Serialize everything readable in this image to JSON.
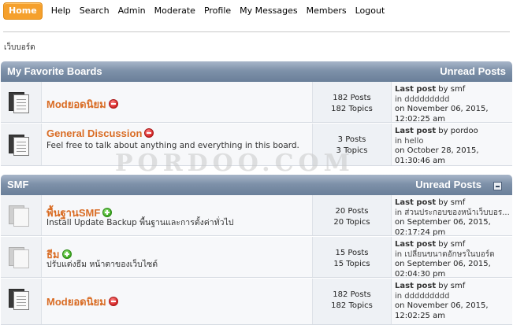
{
  "menu": {
    "items": [
      "Home",
      "Help",
      "Search",
      "Admin",
      "Moderate",
      "Profile",
      "My Messages",
      "Members",
      "Logout"
    ],
    "active": "Home"
  },
  "breadcrumb": "เว็บบอร์ด",
  "watermark": "PORDOO.COM",
  "categories": [
    {
      "title": "My Favorite Boards",
      "unread_label": "Unread Posts",
      "boards": [
        {
          "name": "Modยอดนิยม",
          "status": "red",
          "description": "",
          "posts": "182 Posts",
          "topics": "182 Topics",
          "last_post_label": "Last post",
          "last_post_by": "by smf",
          "last_post_in": "in ddddddddd",
          "last_post_date": "on November 06, 2015,",
          "last_post_time": "12:02:25 am"
        },
        {
          "name": "General Discussion",
          "status": "red",
          "description": "Feel free to talk about anything and everything in this board.",
          "posts": "3 Posts",
          "topics": "3 Topics",
          "last_post_label": "Last post",
          "last_post_by": "by pordoo",
          "last_post_in": "in hello",
          "last_post_date": "on October 28, 2015,",
          "last_post_time": "01:30:46 am"
        }
      ]
    },
    {
      "title": "SMF",
      "unread_label": "Unread Posts",
      "boards": [
        {
          "name": "พื้นฐานSMF",
          "status": "green",
          "description": "Install Update Backup พื้นฐานและการตั้งค่าทั่วไป",
          "posts": "20 Posts",
          "topics": "20 Topics",
          "last_post_label": "Last post",
          "last_post_by": "by smf",
          "last_post_in": "in ส่วนประกอบของหน้าเว็บบอร...",
          "last_post_date": "on September 06, 2015,",
          "last_post_time": "02:17:24 pm"
        },
        {
          "name": "ธีม",
          "status": "green",
          "description": "ปรับแต่งธีม หน้าตาของเว็บไซต์",
          "posts": "15 Posts",
          "topics": "15 Topics",
          "last_post_label": "Last post",
          "last_post_by": "by smf",
          "last_post_in": "in เปลี่ยนขนาดอักษรในบอร์ด",
          "last_post_date": "on September 06, 2015,",
          "last_post_time": "02:04:30 pm"
        },
        {
          "name": "Modยอดนิยม",
          "status": "red",
          "description": "",
          "posts": "182 Posts",
          "topics": "182 Topics",
          "last_post_label": "Last post",
          "last_post_by": "by smf",
          "last_post_in": "in ddddddddd",
          "last_post_date": "on November 06, 2015,",
          "last_post_time": "12:02:25 am"
        }
      ]
    }
  ]
}
